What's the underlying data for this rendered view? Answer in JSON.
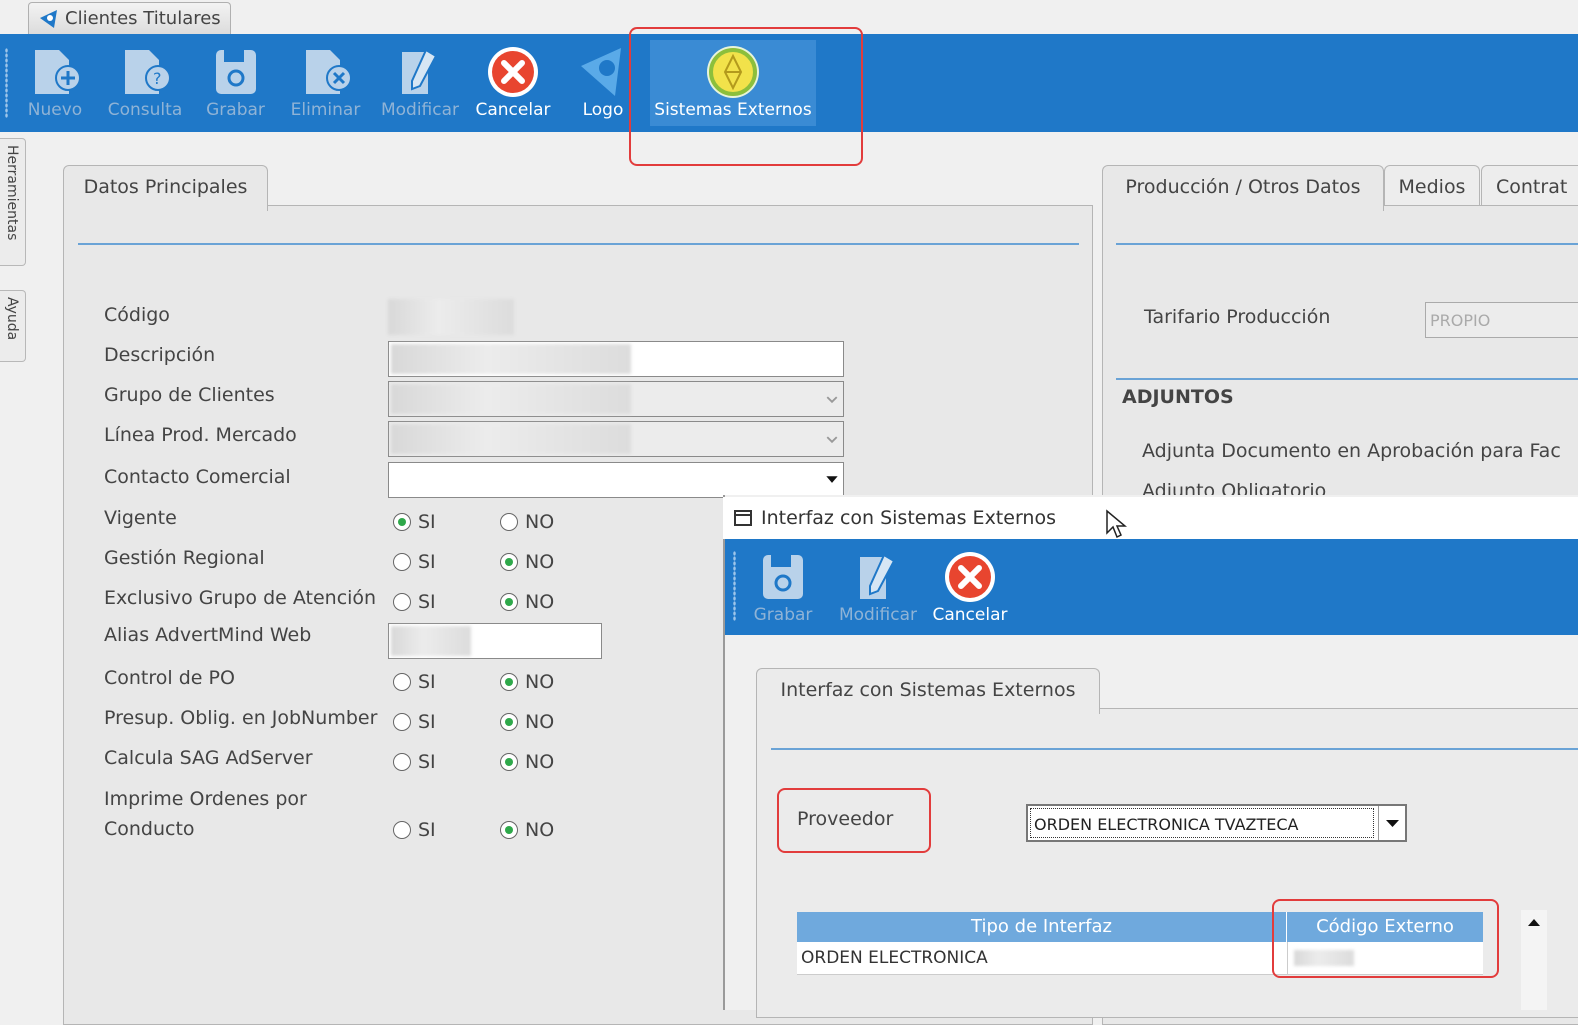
{
  "app": {
    "tab_title": "Clientes Titulares"
  },
  "toolbar": {
    "items": [
      {
        "label": "Nuevo",
        "icon": "new-doc-icon",
        "enabled": false
      },
      {
        "label": "Consulta",
        "icon": "query-doc-icon",
        "enabled": false
      },
      {
        "label": "Grabar",
        "icon": "save-icon",
        "enabled": false
      },
      {
        "label": "Eliminar",
        "icon": "delete-doc-icon",
        "enabled": false
      },
      {
        "label": "Modificar",
        "icon": "edit-icon",
        "enabled": false
      },
      {
        "label": "Cancelar",
        "icon": "cancel-icon",
        "enabled": true
      },
      {
        "label": "Logo",
        "icon": "logo-icon",
        "enabled": true
      },
      {
        "label": "Sistemas Externos",
        "icon": "external-systems-icon",
        "enabled": true
      }
    ]
  },
  "side_tabs": {
    "herramientas": "Herramientas",
    "ayuda": "Ayuda"
  },
  "main_panel": {
    "tab": "Datos Principales",
    "fields": {
      "codigo": "Código",
      "descripcion": "Descripción",
      "grupo": "Grupo de Clientes",
      "linea": "Línea Prod. Mercado",
      "contacto": "Contacto Comercial",
      "vigente": "Vigente",
      "gestion": "Gestión Regional",
      "exclusivo": "Exclusivo Grupo de Atención",
      "alias": "Alias AdvertMind Web",
      "control_po": "Control de PO",
      "presup": "Presup. Oblig. en JobNumber",
      "calcula": "Calcula SAG AdServer",
      "imprime_1": "Imprime Ordenes por",
      "imprime_2": "Conducto"
    },
    "radio_si": "SI",
    "radio_no": "NO",
    "radios": {
      "vigente": "SI",
      "gestion": "NO",
      "exclusivo": "NO",
      "control_po": "NO",
      "presup": "NO",
      "calcula": "NO",
      "imprime": "NO"
    }
  },
  "right_panel": {
    "tabs": [
      "Producción / Otros Datos",
      "Medios",
      "Contrat"
    ],
    "tarifario_label": "Tarifario Producción",
    "tarifario_value": "PROPIO",
    "adjuntos_title": "ADJUNTOS",
    "adjunta_doc": "Adjunta Documento en Aprobación para Fac",
    "adjunto_oblig": "Adjunto Obligatorio"
  },
  "dialog": {
    "title": "Interfaz con Sistemas Externos",
    "toolbar": [
      {
        "label": "Grabar",
        "icon": "save-icon",
        "enabled": false
      },
      {
        "label": "Modificar",
        "icon": "edit-icon",
        "enabled": false
      },
      {
        "label": "Cancelar",
        "icon": "cancel-icon",
        "enabled": true
      }
    ],
    "tab": "Interfaz con Sistemas Externos",
    "proveedor_label": "Proveedor",
    "proveedor_value": "ORDEN ELECTRONICA TVAZTECA",
    "grid": {
      "columns": [
        "Tipo de Interfaz",
        "Código Externo"
      ],
      "rows": [
        [
          "ORDEN ELECTRONICA",
          ""
        ]
      ]
    }
  },
  "colors": {
    "toolbar": "#1f78c8",
    "highlight": "#e23c3c",
    "separator": "#6aa3d6"
  }
}
